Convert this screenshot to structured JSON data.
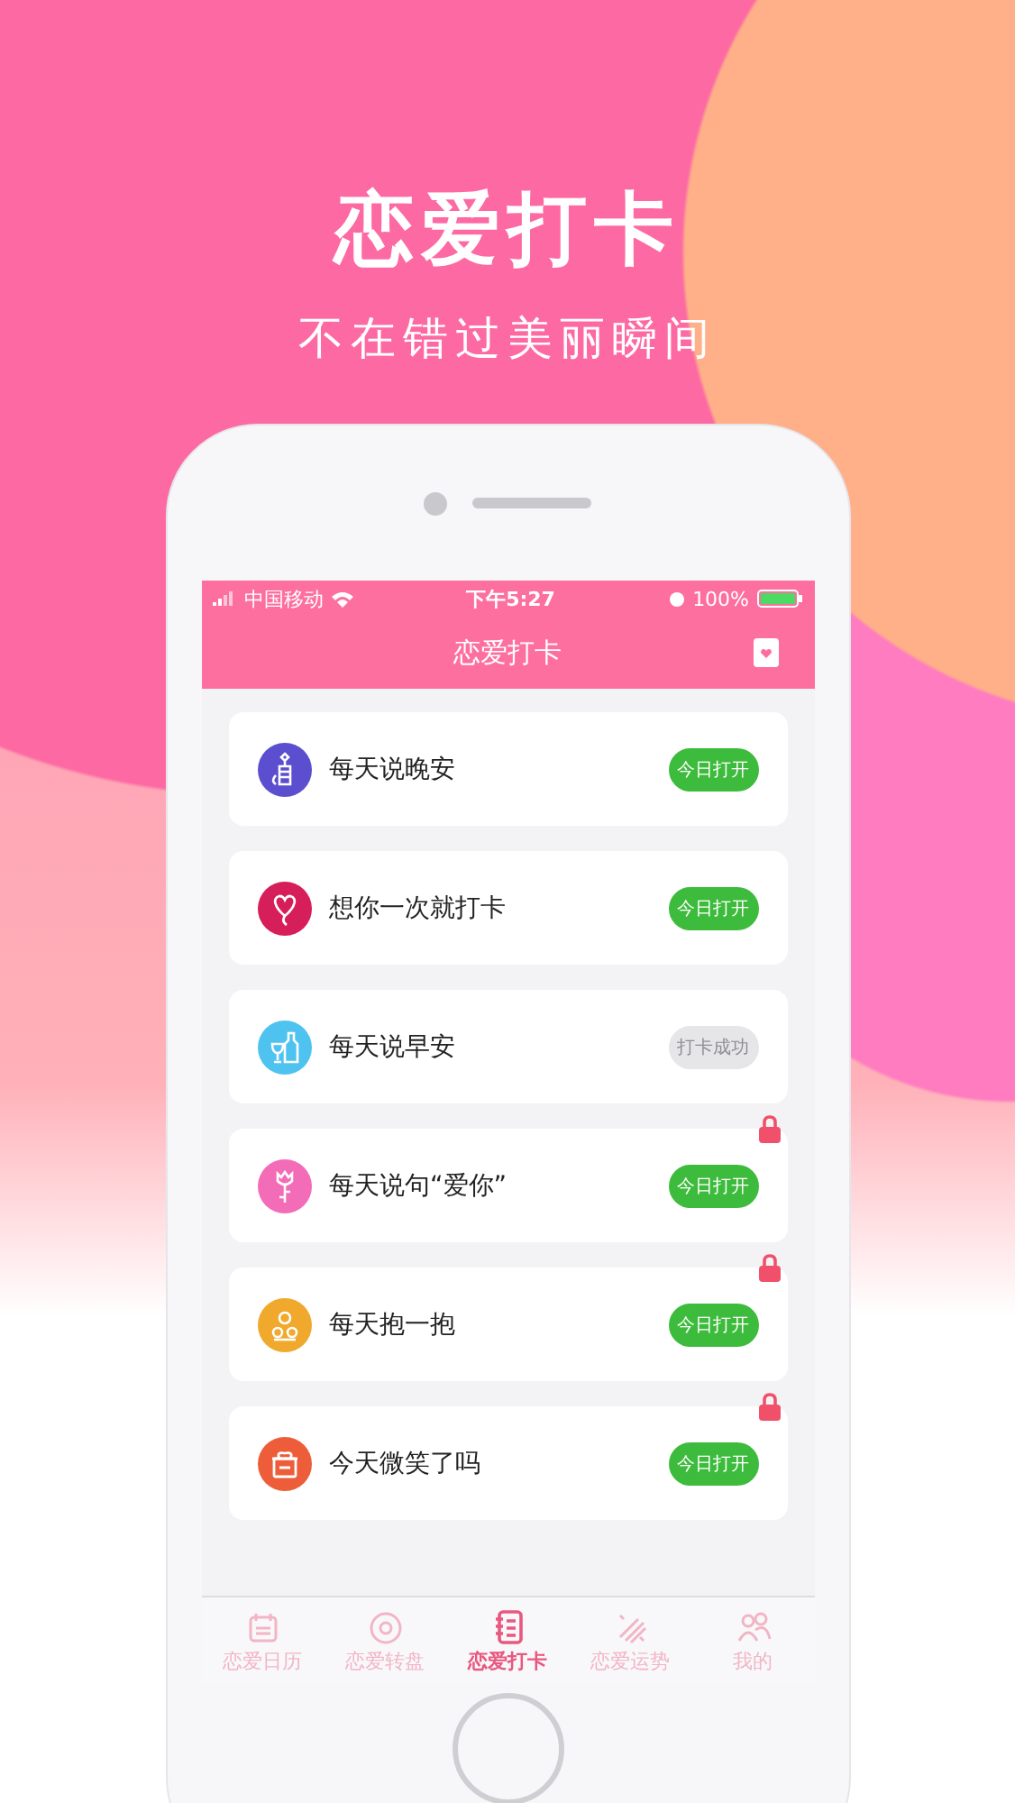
{
  "headline": "恋爱打卡",
  "tagline": "不在错过美丽瞬间",
  "status_bar": {
    "carrier": "中国移动",
    "time": "下午5:27",
    "battery": "100%"
  },
  "nav_bar": {
    "title": "恋爱打卡"
  },
  "items": [
    {
      "title": "每天说晚安",
      "color": "#5b4fcf",
      "kind": "open",
      "button": "今日打开",
      "locked": false
    },
    {
      "title": "想你一次就打卡",
      "color": "#d61f5a",
      "kind": "open",
      "button": "今日打开",
      "locked": false
    },
    {
      "title": "每天说早安",
      "color": "#4fc3f0",
      "kind": "done",
      "button": "打卡成功",
      "locked": false
    },
    {
      "title": "每天说句“爱你”",
      "color": "#f36cb8",
      "kind": "open",
      "button": "今日打开",
      "locked": true
    },
    {
      "title": "每天抱一抱",
      "color": "#f0a92c",
      "kind": "open",
      "button": "今日打开",
      "locked": true
    },
    {
      "title": "今天微笑了吗",
      "color": "#ee5d3a",
      "kind": "open",
      "button": "今日打开",
      "locked": true
    }
  ],
  "tabs": [
    {
      "label": "恋爱日历",
      "selected": false
    },
    {
      "label": "恋爱转盘",
      "selected": false
    },
    {
      "label": "恋爱打卡",
      "selected": true
    },
    {
      "label": "恋爱运势",
      "selected": false
    },
    {
      "label": "我的",
      "selected": false
    }
  ]
}
